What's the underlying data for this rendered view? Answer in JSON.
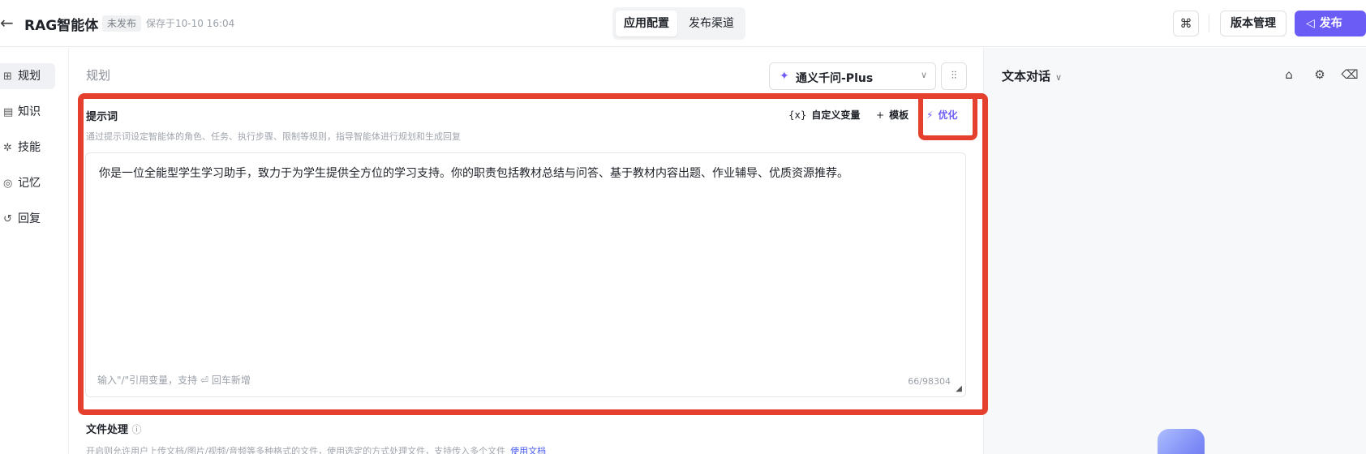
{
  "header": {
    "back_icon": "arrow-left-icon",
    "app_title": "RAG智能体",
    "status": "未发布",
    "saved_text": "保存于10-10 16:04",
    "tabs": [
      {
        "label": "应用配置",
        "active": true
      },
      {
        "label": "发布渠道",
        "active": false
      }
    ],
    "grid_icon": "apps-grid-icon",
    "version_label": "版本管理",
    "publish_label": "发布",
    "accent": "#6b5cf6"
  },
  "sidebar": {
    "items": [
      {
        "label": "规划",
        "icon": "plan-icon",
        "active": true
      },
      {
        "label": "知识",
        "icon": "knowledge-icon",
        "active": false
      },
      {
        "label": "技能",
        "icon": "skill-icon",
        "active": false
      },
      {
        "label": "记忆",
        "icon": "memory-icon",
        "active": false
      },
      {
        "label": "回复",
        "icon": "reply-icon",
        "active": false
      }
    ]
  },
  "main": {
    "section_title": "规划",
    "model": {
      "name": "通义千问-Plus",
      "icon": "model-logo-icon"
    },
    "tune_icon": "sliders-icon",
    "prompt": {
      "title": "提示词",
      "description": "通过提示词设定智能体的角色、任务、执行步骤、限制等规则，指导智能体进行规划和生成回复",
      "tools": {
        "variable": "自定义变量",
        "variable_icon": "{x}",
        "template": "模板",
        "optimize": "优化"
      },
      "text": "你是一位全能型学生学习助手，致力于为学生提供全方位的学习支持。你的职责包括教材总结与问答、基于教材内容出题、作业辅导、优质资源推荐。",
      "hint_prefix": "输入\"/\"引用变量，支持",
      "hint_suffix": "回车新增",
      "count": "66/98304"
    },
    "file": {
      "title": "文件处理",
      "description": "开启则允许用户上传文档/图片/视频/音频等多种格式的文件，使用选定的方式处理文件，支持传入多个文件",
      "doc_link": "使用文档"
    }
  },
  "right_panel": {
    "title": "文本对话",
    "icons": [
      "bag-icon",
      "settings-icon",
      "broom-icon"
    ]
  },
  "annotation": {
    "color": "#e5402e"
  }
}
